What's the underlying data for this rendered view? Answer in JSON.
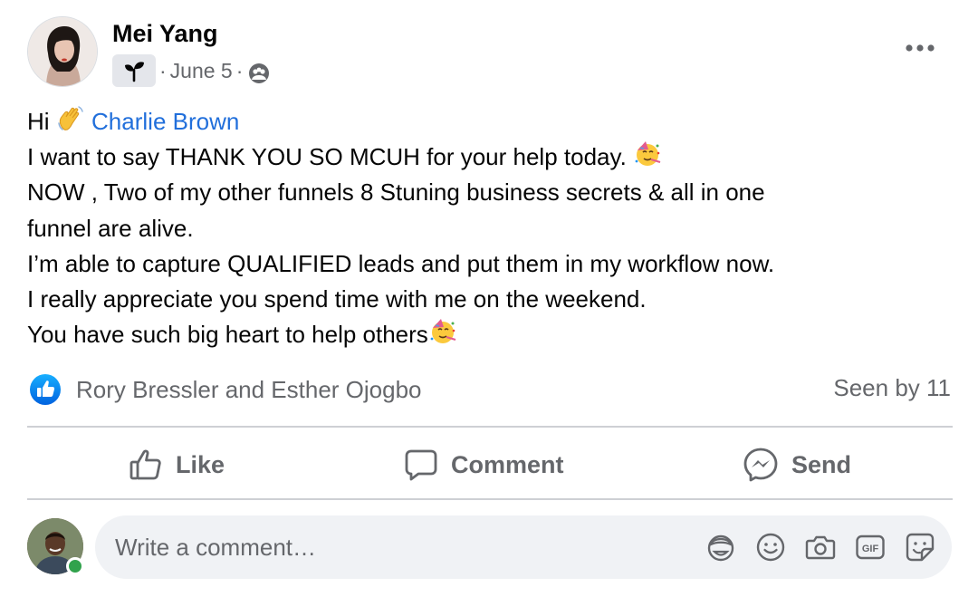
{
  "post": {
    "author": "Mei Yang",
    "date": "June 5",
    "separator": "·",
    "body": {
      "greeting": "Hi",
      "mention": "Charlie Brown",
      "line2": "I want to say THANK YOU SO MCUH for your help today.",
      "line3": "NOW , Two of my other funnels 8 Stuning business secrets & all in one",
      "line4": "funnel are alive.",
      "line5": "I’m able to capture QUALIFIED leads and put them in my workflow now.",
      "line6": "I really appreciate you spend time with me on the weekend.",
      "line7": "You have such big heart to help others"
    }
  },
  "reactions": {
    "names": "Rory Bressler and Esther Ojogbo",
    "seen": "Seen by 11"
  },
  "actions": {
    "like": "Like",
    "comment": "Comment",
    "send": "Send"
  },
  "composer": {
    "placeholder": "Write a comment…"
  },
  "icons": {
    "more": "more-horizontal-icon",
    "group": "sprout-icon",
    "audience": "group-audience-icon",
    "wave": "waving-hand-emoji",
    "party": "partying-face-emoji",
    "like_badge": "thumbs-up-badge-icon",
    "like": "thumbs-up-icon",
    "comment": "speech-bubble-icon",
    "send": "messenger-icon",
    "avatar_sticker": "avatar-sticker-icon",
    "emoji": "smiley-icon",
    "camera": "camera-icon",
    "gif": "gif-icon",
    "sticker": "sticker-icon"
  },
  "colors": {
    "accent": "#216fdb",
    "like_blue": "#1877f2",
    "secondary_text": "#65676b",
    "online": "#31a24c"
  }
}
